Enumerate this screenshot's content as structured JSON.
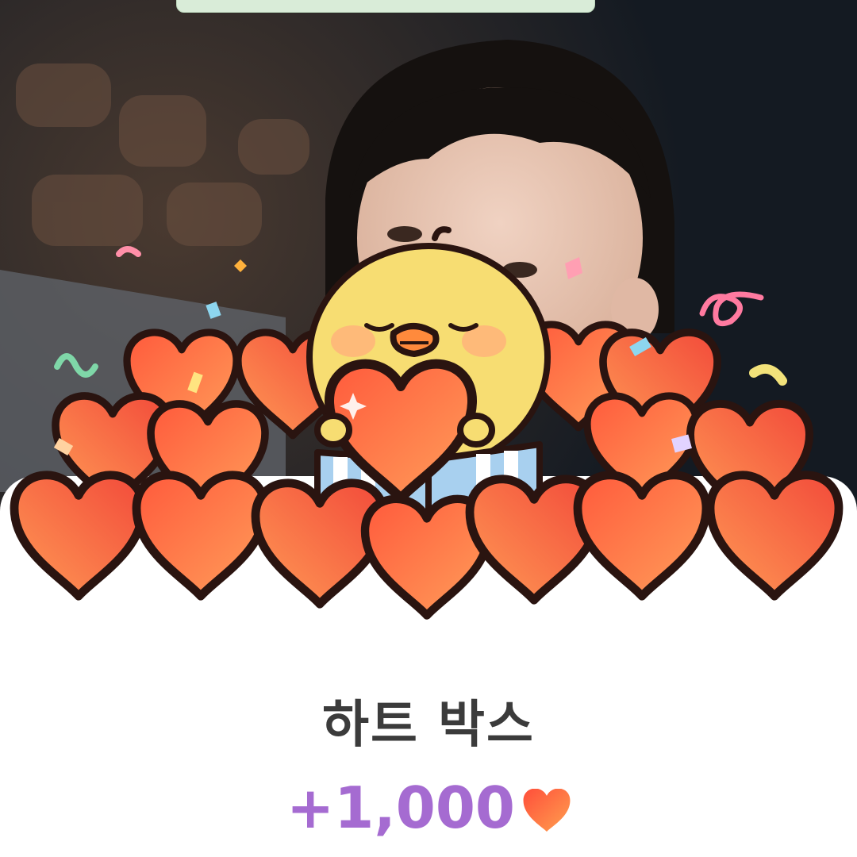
{
  "reward_item": {
    "title": "하트 박스",
    "amount": "+1,000",
    "currency_icon": "heart-icon"
  },
  "colors": {
    "title_text": "#3b3b3b",
    "amount_text": "#a56bd1",
    "heart_light": "#ff9e5a",
    "heart_dark": "#f24a3a",
    "chick_yellow": "#f7dd72",
    "sheet": "#ffffff"
  }
}
